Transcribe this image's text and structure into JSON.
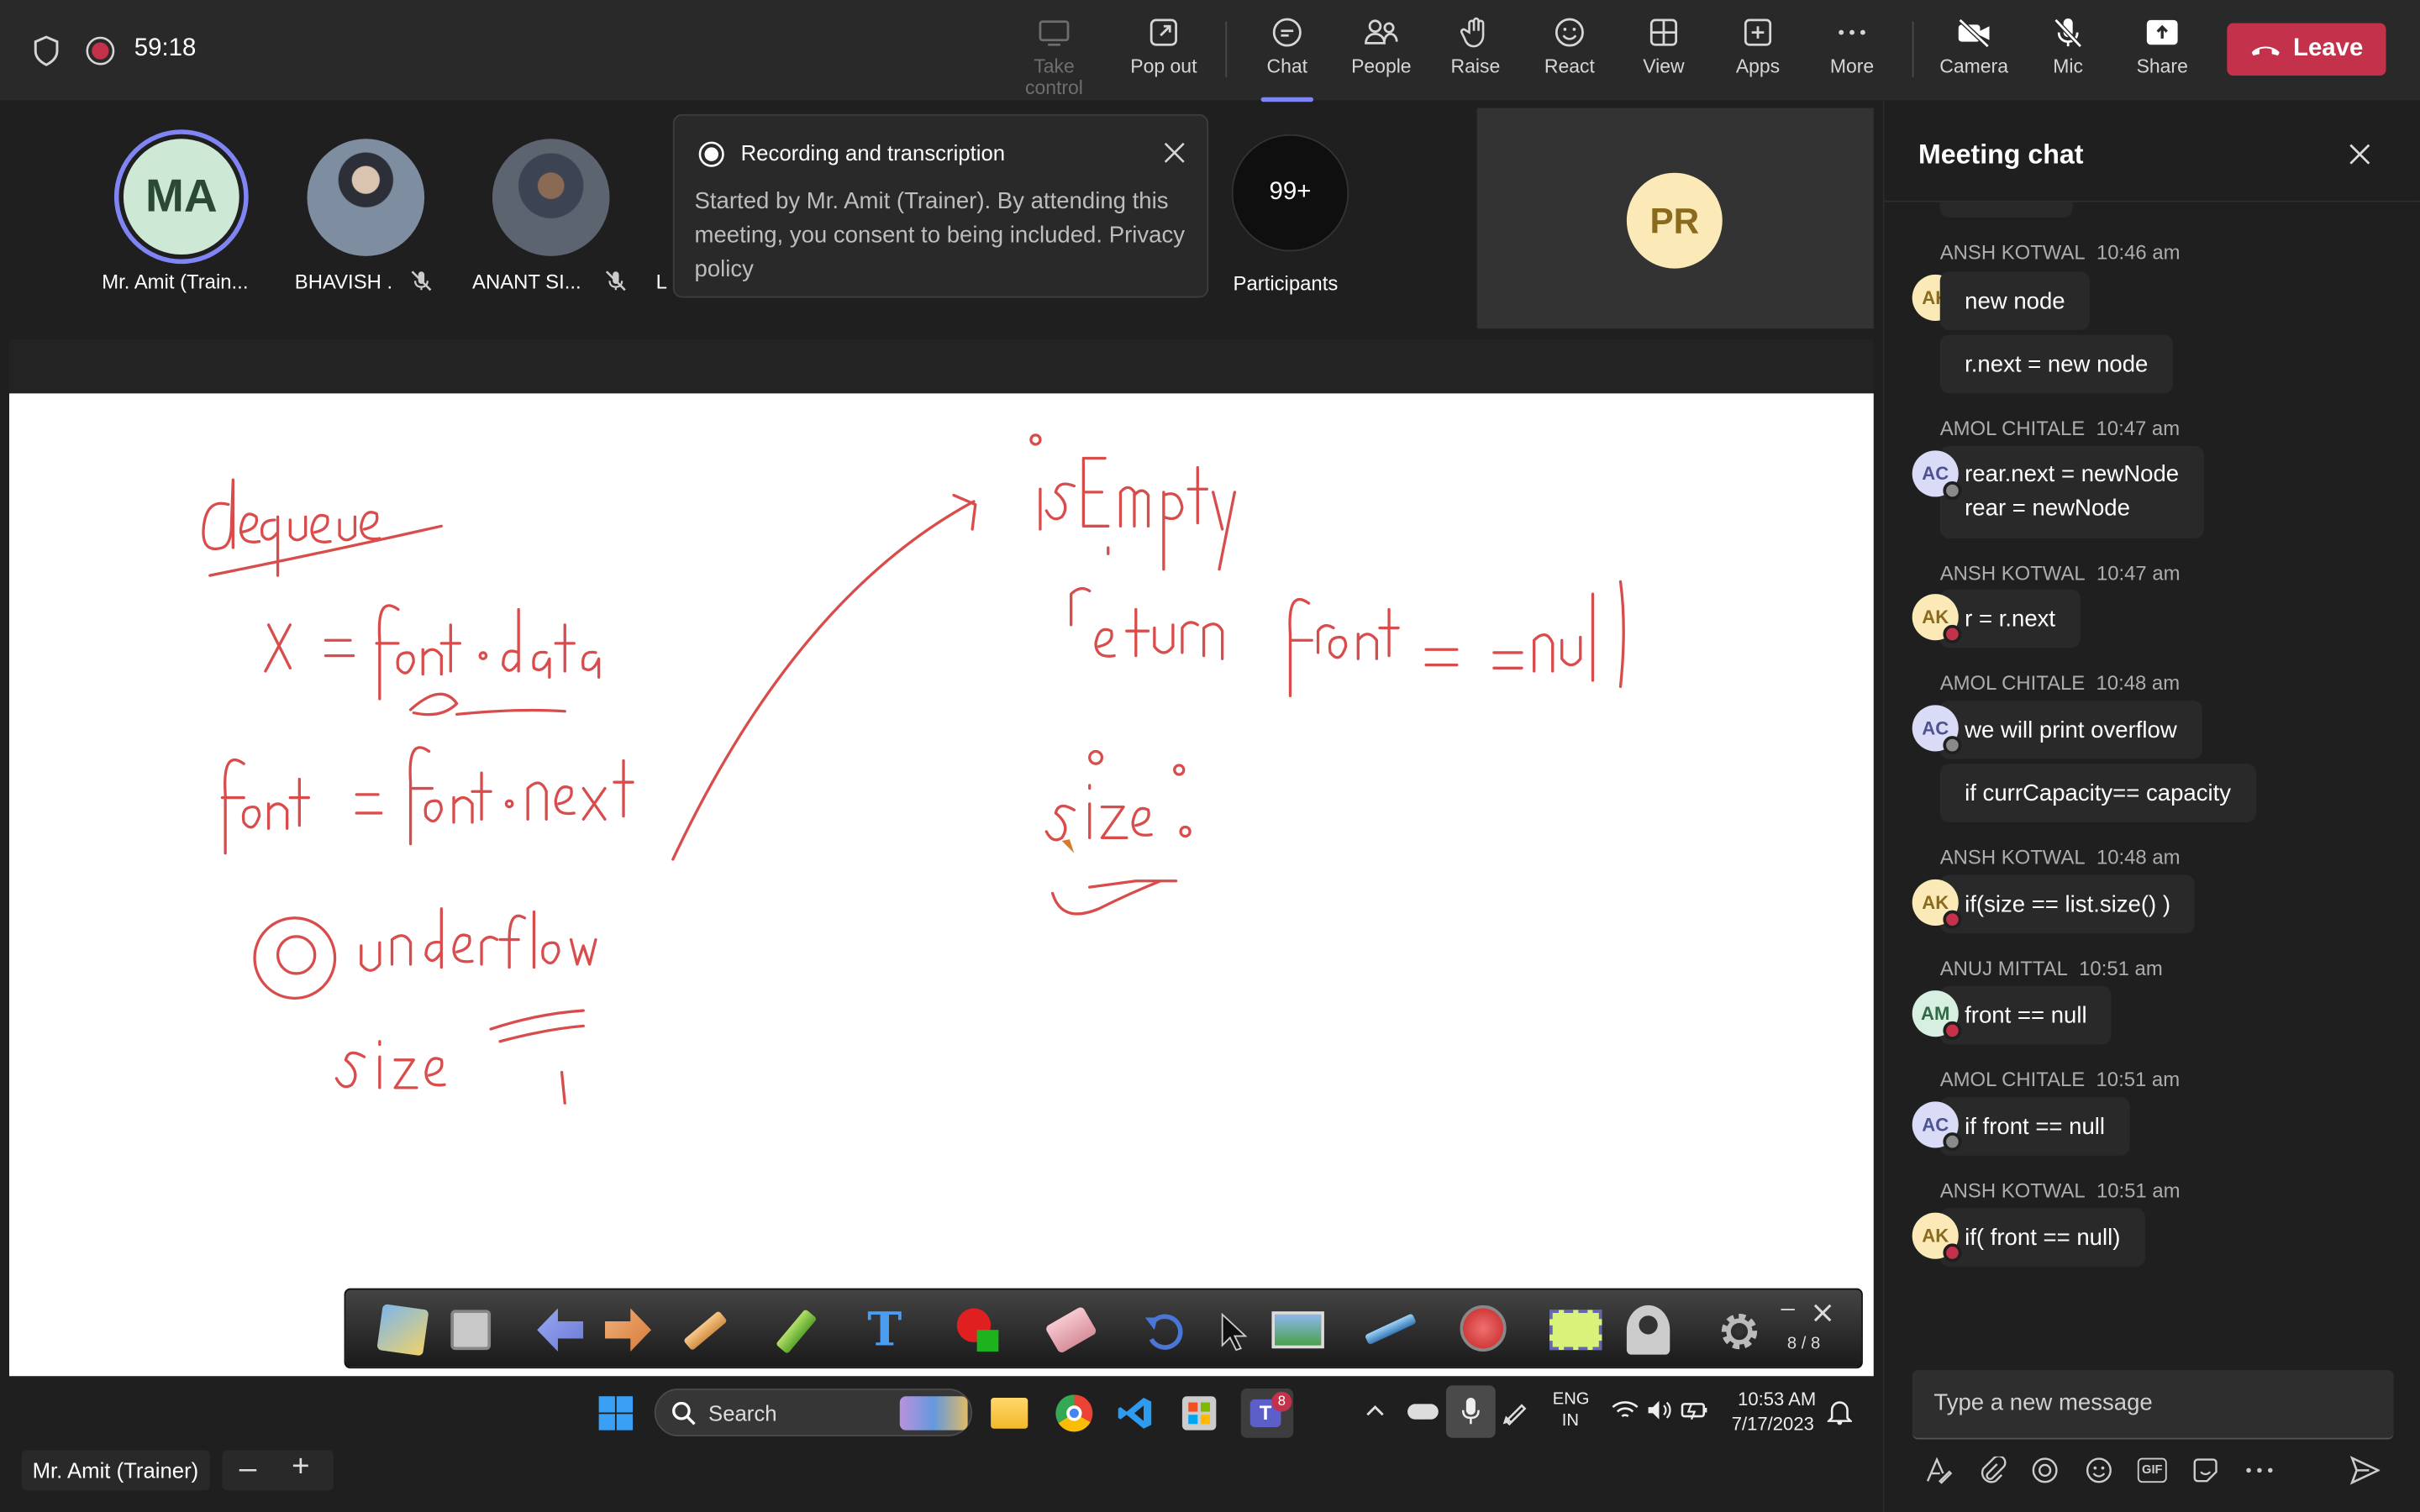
{
  "top_bar": {
    "timer": "59:18",
    "buttons": [
      {
        "label": "Take control",
        "icon": "take-control-icon",
        "disabled": true
      },
      {
        "label": "Pop out",
        "icon": "pop-out-icon"
      },
      {
        "label": "Chat",
        "icon": "chat-icon",
        "active": true
      },
      {
        "label": "People",
        "icon": "people-icon"
      },
      {
        "label": "Raise",
        "icon": "raise-hand-icon"
      },
      {
        "label": "React",
        "icon": "react-icon"
      },
      {
        "label": "View",
        "icon": "view-icon"
      },
      {
        "label": "Apps",
        "icon": "apps-icon"
      },
      {
        "label": "More",
        "icon": "more-icon"
      },
      {
        "label": "Camera",
        "icon": "camera-off-icon"
      },
      {
        "label": "Mic",
        "icon": "mic-off-icon"
      },
      {
        "label": "Share",
        "icon": "share-icon"
      }
    ],
    "leave_label": "Leave"
  },
  "participants": {
    "items": [
      {
        "initials": "MA",
        "name": "Mr. Amit (Train..."
      },
      {
        "name": "BHAVISH ."
      },
      {
        "name": "ANANT SI..."
      },
      {
        "name": "L"
      }
    ],
    "overflow_count": "99+",
    "overflow_label": "Participants",
    "tile_initials": "PR"
  },
  "recording_popup": {
    "title": "Recording and transcription",
    "body": "Started by Mr. Amit (Trainer). By attending this meeting, you consent to being included.",
    "link": "Privacy policy"
  },
  "whiteboard": {
    "page_indicator": "8 / 8"
  },
  "taskbar": {
    "search_label": "Search",
    "lang_1": "ENG",
    "lang_2": "IN",
    "time": "10:53 AM",
    "date": "7/17/2023",
    "teams_badge": "8"
  },
  "bottom_bar": {
    "presenter": "Mr. Amit (Trainer)"
  },
  "chat": {
    "title": "Meeting chat",
    "input_placeholder": "Type a new message",
    "messages": [
      {
        "author": "ANSH KOTWAL",
        "time": "10:46 am",
        "initials": "AK",
        "lines": [
          "new node"
        ]
      },
      {
        "continuation": true,
        "lines": [
          "r.next = new node"
        ]
      },
      {
        "author": "AMOL CHITALE",
        "time": "10:47 am",
        "initials": "AC",
        "lines": [
          "rear.next = newNode",
          "rear = newNode"
        ]
      },
      {
        "author": "ANSH KOTWAL",
        "time": "10:47 am",
        "initials": "AK",
        "lines": [
          "r = r.next"
        ]
      },
      {
        "author": "AMOL CHITALE",
        "time": "10:48 am",
        "initials": "AC",
        "lines": [
          "we will print overflow"
        ]
      },
      {
        "continuation": true,
        "lines": [
          "if currCapacity== capacity"
        ]
      },
      {
        "author": "ANSH KOTWAL",
        "time": "10:48 am",
        "initials": "AK",
        "lines": [
          "if(size == list.size() )"
        ]
      },
      {
        "author": "ANUJ MITTAL",
        "time": "10:51 am",
        "initials": "AM",
        "lines": [
          "front == null"
        ]
      },
      {
        "author": "AMOL CHITALE",
        "time": "10:51 am",
        "initials": "AC",
        "lines": [
          "if front == null"
        ]
      },
      {
        "author": "ANSH KOTWAL",
        "time": "10:51 am",
        "initials": "AK",
        "lines": [
          "if( front == null)"
        ]
      }
    ]
  }
}
